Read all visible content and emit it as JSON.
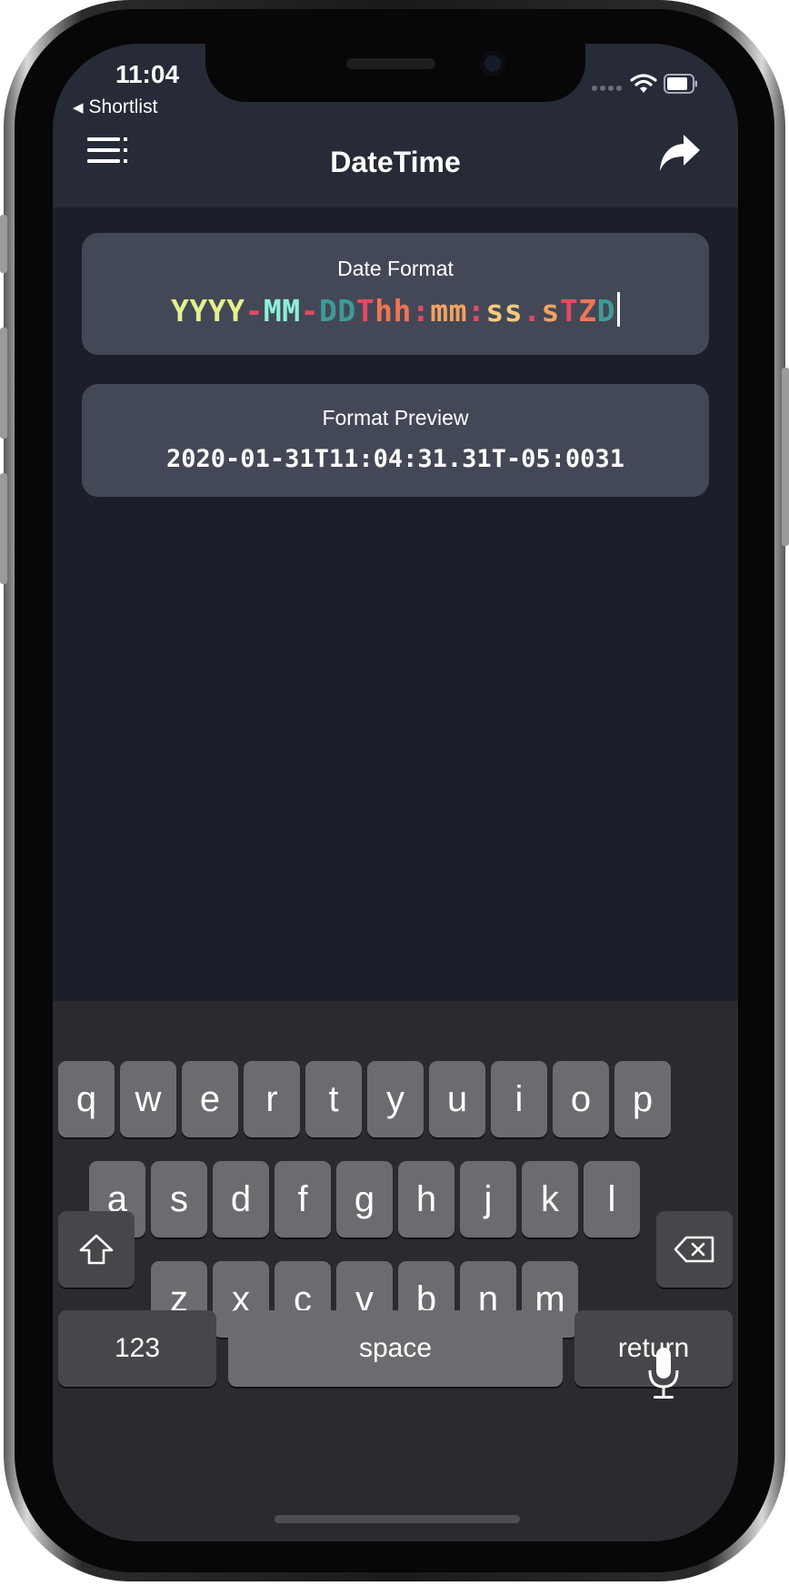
{
  "status_bar": {
    "time": "11:04",
    "back_label": "Shortlist"
  },
  "nav": {
    "title": "DateTime",
    "menu_icon": "list-menu-icon",
    "share_icon": "share-arrow-icon"
  },
  "date_format": {
    "label": "Date Format",
    "segments": [
      {
        "text": "YYYY",
        "color": "#e4f08e"
      },
      {
        "text": "-",
        "color": "#e34a63"
      },
      {
        "text": "MM",
        "color": "#8df0d8"
      },
      {
        "text": "-",
        "color": "#e34a63"
      },
      {
        "text": "DD",
        "color": "#3f9a98"
      },
      {
        "text": "T",
        "color": "#e34a63"
      },
      {
        "text": "hh",
        "color": "#f07553"
      },
      {
        "text": ":",
        "color": "#e34a63"
      },
      {
        "text": "mm",
        "color": "#f2a35f"
      },
      {
        "text": ":",
        "color": "#e34a63"
      },
      {
        "text": "ss",
        "color": "#f6c97c"
      },
      {
        "text": ".",
        "color": "#e34a63"
      },
      {
        "text": "s",
        "color": "#f2a35f"
      },
      {
        "text": "T",
        "color": "#e34a63"
      },
      {
        "text": "Z",
        "color": "#f07553"
      },
      {
        "text": "D",
        "color": "#3f9a98"
      }
    ]
  },
  "format_preview": {
    "label": "Format Preview",
    "value": "2020-01-31T11:04:31.31T-05:0031"
  },
  "keyboard": {
    "row1": [
      "q",
      "w",
      "e",
      "r",
      "t",
      "y",
      "u",
      "i",
      "o",
      "p"
    ],
    "row2": [
      "a",
      "s",
      "d",
      "f",
      "g",
      "h",
      "j",
      "k",
      "l"
    ],
    "row3": [
      "z",
      "x",
      "c",
      "v",
      "b",
      "n",
      "m"
    ],
    "numbers_label": "123",
    "space_label": "space",
    "return_label": "return"
  }
}
